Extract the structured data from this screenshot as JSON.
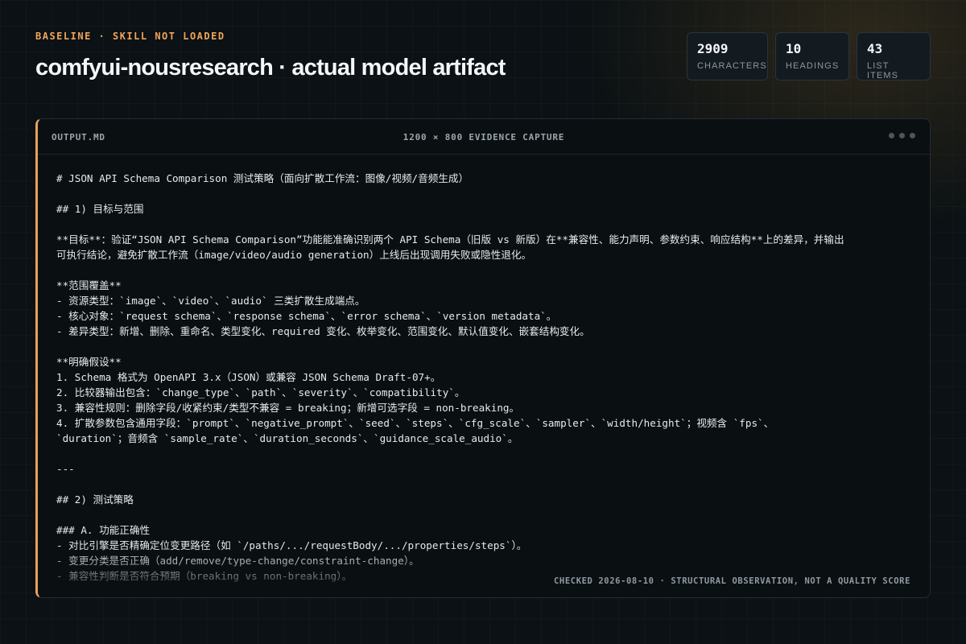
{
  "header": {
    "kicker": "BASELINE · SKILL NOT LOADED",
    "title": "comfyui-nousresearch · actual model artifact"
  },
  "stats": [
    {
      "value": "2909",
      "label": "Characters"
    },
    {
      "value": "10",
      "label": "Headings"
    },
    {
      "value": "43",
      "label": "List items"
    }
  ],
  "panel": {
    "filename": "OUTPUT.MD",
    "caption": "1200 × 800 EVIDENCE CAPTURE",
    "footer": "CHECKED 2026-08-10 · STRUCTURAL OBSERVATION, NOT A QUALITY SCORE",
    "lines": [
      "# JSON API Schema Comparison 测试策略（面向扩散工作流：图像/视频/音频生成）",
      "",
      "## 1) 目标与范围",
      "",
      "**目标**：验证“JSON API Schema Comparison”功能能准确识别两个 API Schema（旧版 vs 新版）在**兼容性、能力声明、参数约束、响应结构**上的差异，并输出",
      "可执行结论，避免扩散工作流（image/video/audio generation）上线后出现调用失败或隐性退化。",
      "",
      "**范围覆盖**",
      "- 资源类型：`image`、`video`、`audio` 三类扩散生成端点。",
      "- 核心对象：`request schema`、`response schema`、`error schema`、`version metadata`。",
      "- 差异类型：新增、删除、重命名、类型变化、required 变化、枚举变化、范围变化、默认值变化、嵌套结构变化。",
      "",
      "**明确假设**",
      "1. Schema 格式为 OpenAPI 3.x（JSON）或兼容 JSON Schema Draft-07+。",
      "2. 比较器输出包含：`change_type`、`path`、`severity`、`compatibility`。",
      "3. 兼容性规则：删除字段/收紧约束/类型不兼容 = breaking；新增可选字段 = non-breaking。",
      "4. 扩散参数包含通用字段：`prompt`、`negative_prompt`、`seed`、`steps`、`cfg_scale`、`sampler`、`width/height`；视频含 `fps`、",
      "`duration`；音频含 `sample_rate`、`duration_seconds`、`guidance_scale_audio`。",
      "",
      "---",
      "",
      "## 2) 测试策略",
      "",
      "### A. 功能正确性",
      "- 对比引擎是否精确定位变更路径（如 `/paths/.../requestBody/.../properties/steps`）。",
      "- 变更分类是否正确（add/remove/type-change/constraint-change）。",
      "- 兼容性判断是否符合预期（breaking vs non-breaking）。"
    ]
  }
}
